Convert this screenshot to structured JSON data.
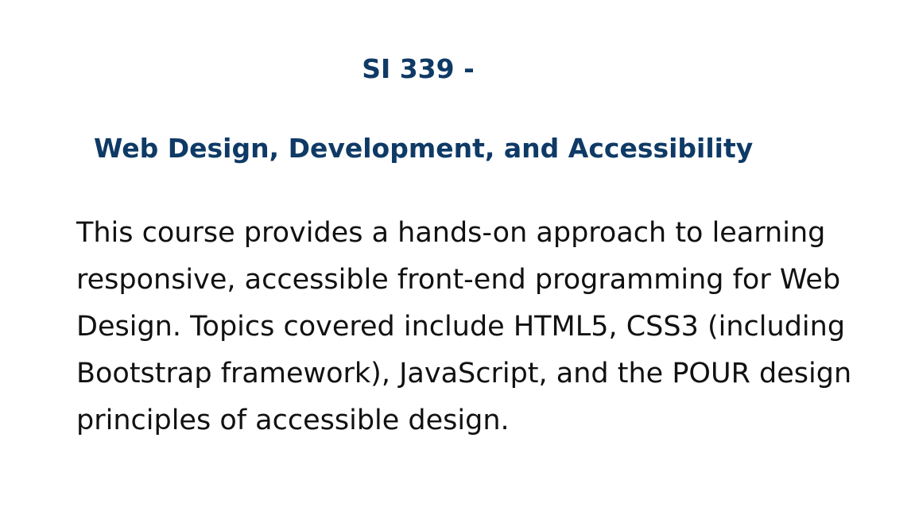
{
  "heading": {
    "course_code": "SI 339 -",
    "course_title": "Web Design, Development, and Accessibility"
  },
  "description": {
    "lines": [
      "This course provides a hands-on approach to learning",
      "responsive, accessible front-end programming for Web",
      "Design. Topics covered include HTML5, CSS3 (including",
      "Bootstrap framework), JavaScript, and the POUR design",
      "principles of accessible design."
    ]
  },
  "colors": {
    "heading": "#0f3a66",
    "body_text": "#111111",
    "background": "#ffffff"
  }
}
